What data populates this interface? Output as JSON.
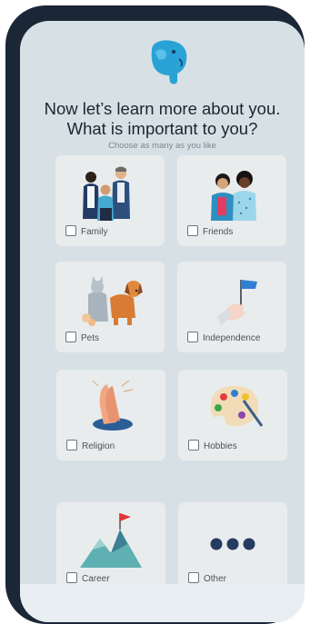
{
  "header": {
    "logo": "elephant-logo",
    "title_line1": "Now let’s learn more about you.",
    "title_line2": "What is important to you?",
    "subtitle": "Choose as many as you like"
  },
  "options": [
    {
      "label": "Family",
      "icon": "family-illustration"
    },
    {
      "label": "Friends",
      "icon": "friends-illustration"
    },
    {
      "label": "Pets",
      "icon": "pets-illustration"
    },
    {
      "label": "Independence",
      "icon": "flag-hand-illustration"
    },
    {
      "label": "Religion",
      "icon": "praying-hands-illustration"
    },
    {
      "label": "Hobbies",
      "icon": "paint-palette-illustration"
    },
    {
      "label": "Career",
      "icon": "mountain-flag-illustration"
    },
    {
      "label": "Other",
      "icon": "dots-illustration"
    }
  ],
  "colors": {
    "frame": "#1b2737",
    "screen": "#d7e1e5",
    "card": "#e9eced",
    "brand_blue": "#2aa2d6",
    "navy": "#243b63"
  }
}
